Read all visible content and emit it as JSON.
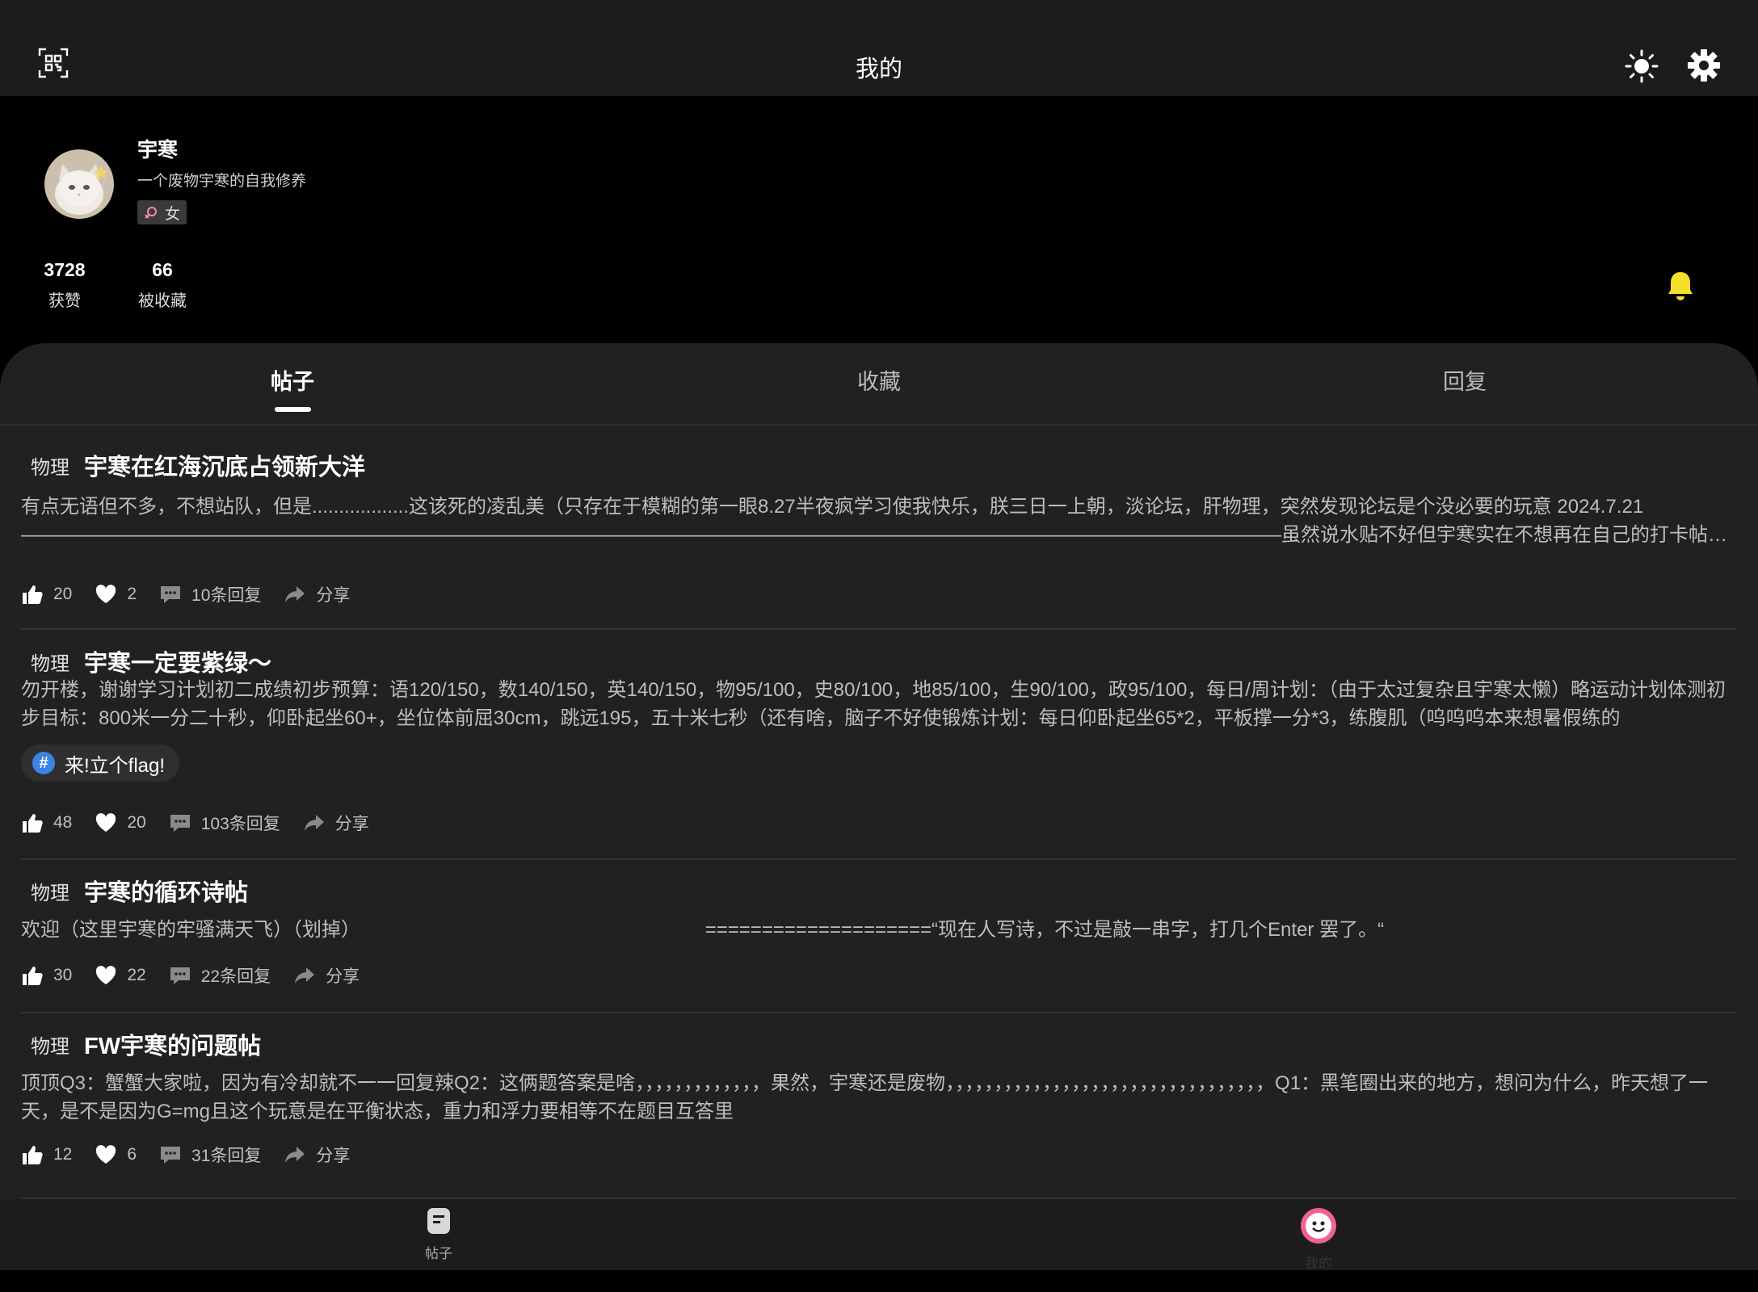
{
  "header": {
    "title": "我的",
    "scan_icon": "qr-scan-icon",
    "theme_icon": "sun-icon",
    "settings_icon": "gear-icon"
  },
  "profile": {
    "username": "宇寒",
    "bio": "一个废物宇寒的自我修养",
    "gender": "女",
    "stats": [
      {
        "value": "3728",
        "label": "获赞"
      },
      {
        "value": "66",
        "label": "被收藏"
      }
    ]
  },
  "tabs": [
    {
      "label": "帖子",
      "active": true
    },
    {
      "label": "收藏",
      "active": false
    },
    {
      "label": "回复",
      "active": false
    }
  ],
  "posts": [
    {
      "category": "物理",
      "title": "宇寒在红海沉底占领新大洋",
      "body": "有点无语但不多，不想站队，但是..................这该死的凌乱美（只存在于模糊的第一眼8.27半夜疯学习使我快乐，朕三日一上朝，淡论坛，肝物理，突然发现论坛是个没必要的玩意 2024.7.21—————————————————————————————————————————————————————————————————虽然说水贴不好但宇寒实在不想再在自己的打卡帖里水了",
      "tag": "",
      "likes": "20",
      "favs": "2",
      "replies": "10条回复",
      "share": "分享"
    },
    {
      "category": "物理",
      "title": "宇寒一定要紫绿～",
      "body": "勿开楼，谢谢学习计划初二成绩初步预算：语120/150，数140/150，英140/150，物95/100，史80/100，地85/100，生90/100，政95/100，每日/周计划：（由于太过复杂且宇寒太懒）略运动计划体测初步目标：800米一分二十秒，仰卧起坐60+，坐位体前屈30cm，跳远195，五十米七秒（还有啥，脑子不好使锻炼计划：每日仰卧起坐65*2，平板撑一分*3，练腹肌（呜呜呜本来想暑假练的",
      "tag": "来!立个flag!",
      "likes": "48",
      "favs": "20",
      "replies": "103条回复",
      "share": "分享"
    },
    {
      "category": "物理",
      "title": "宇寒的循环诗帖",
      "body": "欢迎（这里宇寒的牢骚满天飞）（划掉）                                                                ====================“现在人写诗，不过是敲一串字，打几个Enter 罢了。“",
      "tag": "",
      "likes": "30",
      "favs": "22",
      "replies": "22条回复",
      "share": "分享"
    },
    {
      "category": "物理",
      "title": "FW宇寒的问题帖",
      "body": "顶顶Q3：蟹蟹大家啦，因为有冷却就不一一回复辣Q2：这俩题答案是啥，，，，，，，，，，，，，果然，宇寒还是废物，，，，，，，，，，，，，，，，，，，，，，，，，，，，，，，，，Q1：黑笔圈出来的地方，想问为什么，昨天想了一天，是不是因为G=mg且这个玩意是在平衡状态，重力和浮力要相等不在题目互答里",
      "tag": "",
      "likes": "12",
      "favs": "6",
      "replies": "31条回复",
      "share": "分享"
    }
  ],
  "bottom_nav": [
    {
      "label": "帖子",
      "icon": "posts-icon",
      "active": false
    },
    {
      "label": "我的",
      "icon": "smiley-icon",
      "active": true
    }
  ]
}
